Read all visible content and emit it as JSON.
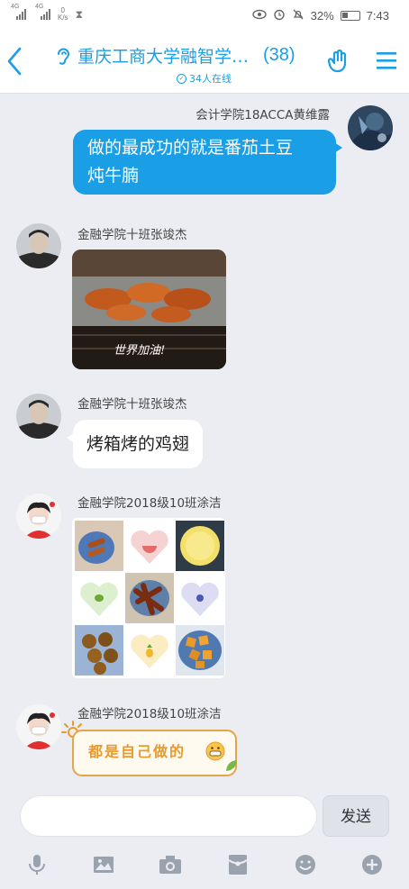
{
  "status_bar": {
    "signal1": "4G",
    "signal2": "4G",
    "speed_value": "0",
    "speed_unit": "K/s",
    "battery": "32%",
    "time": "7:43"
  },
  "header": {
    "title": "重庆工商大学融智学…",
    "member_count": "(38)",
    "online": "34人在线"
  },
  "messages": [
    {
      "sender": "会计学院18ACCA黄维露",
      "text": "做的最成功的就是番茄土豆炖牛腩",
      "line1": "做的最成功的就是番茄土豆",
      "line2": "炖牛腩"
    },
    {
      "sender": "金融学院十班张竣杰",
      "photo_caption": "世界加油!"
    },
    {
      "sender": "金融学院十班张竣杰",
      "text": "烤箱烤的鸡翅"
    },
    {
      "sender": "金融学院2018级10班涂洁"
    },
    {
      "sender": "金融学院2018级10班涂洁",
      "sticker_text": "都是自己做的"
    }
  ],
  "input": {
    "placeholder": "",
    "send_label": "发送"
  },
  "toolbar": [
    "microphone-icon",
    "image-icon",
    "camera-icon",
    "red-packet-icon",
    "emoji-icon",
    "plus-icon"
  ],
  "colors": {
    "accent": "#1a9ee6",
    "background": "#ebedf2",
    "sticker": "#e89a2c"
  }
}
